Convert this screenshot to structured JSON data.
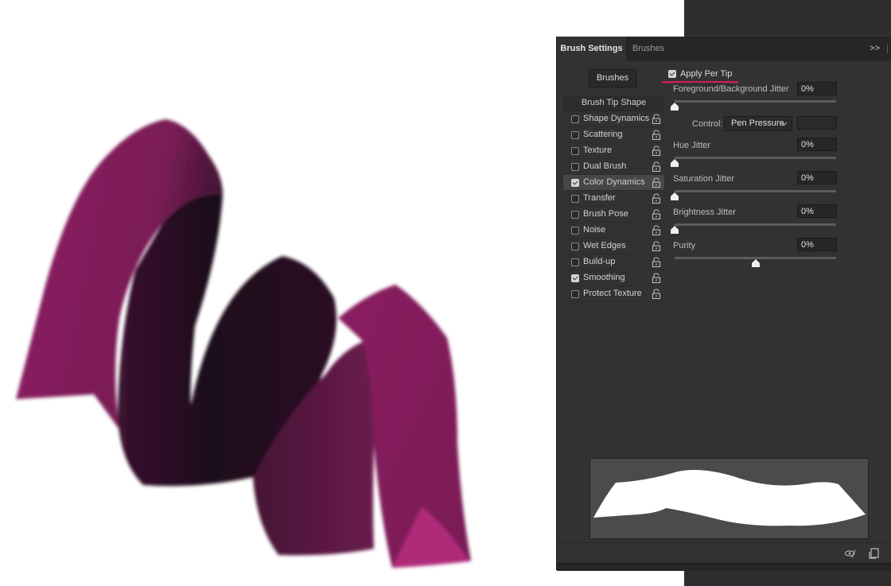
{
  "panel": {
    "tabs": [
      {
        "label": "Brush Settings",
        "active": true
      },
      {
        "label": "Brushes",
        "active": false
      }
    ],
    "menu_icon": "double-chevron-right-icon",
    "brushes_button": "Brushes",
    "list_header": "Brush Tip Shape",
    "items": [
      {
        "label": "Shape Dynamics",
        "checked": false,
        "selected": false
      },
      {
        "label": "Scattering",
        "checked": false,
        "selected": false
      },
      {
        "label": "Texture",
        "checked": false,
        "selected": false
      },
      {
        "label": "Dual Brush",
        "checked": false,
        "selected": false
      },
      {
        "label": "Color Dynamics",
        "checked": true,
        "selected": true
      },
      {
        "label": "Transfer",
        "checked": false,
        "selected": false
      },
      {
        "label": "Brush Pose",
        "checked": false,
        "selected": false
      },
      {
        "label": "Noise",
        "checked": false,
        "selected": false
      },
      {
        "label": "Wet Edges",
        "checked": false,
        "selected": false
      },
      {
        "label": "Build-up",
        "checked": false,
        "selected": false
      },
      {
        "label": "Smoothing",
        "checked": true,
        "selected": false
      },
      {
        "label": "Protect Texture",
        "checked": false,
        "selected": false
      }
    ],
    "apply_per_tip": {
      "label": "Apply Per Tip",
      "checked": true
    },
    "fg_bg_jitter": {
      "label": "Foreground/Background Jitter",
      "value": "0%",
      "fraction": 0
    },
    "control": {
      "label": "Control:",
      "value": "Pen Pressure"
    },
    "hue_jitter": {
      "label": "Hue Jitter",
      "value": "0%",
      "fraction": 0
    },
    "saturation_jitter": {
      "label": "Saturation Jitter",
      "value": "0%",
      "fraction": 0
    },
    "brightness_jitter": {
      "label": "Brightness Jitter",
      "value": "0%",
      "fraction": 0
    },
    "purity": {
      "label": "Purity",
      "value": "0%",
      "fraction": 0.5
    },
    "footer_icons": [
      "toggle-live-tip-preview-icon",
      "create-new-brush-icon"
    ]
  },
  "colors": {
    "stroke_light": "#8e2163",
    "stroke_dark": "#1e0d1c",
    "stroke_mid": "#5c1a45",
    "stroke_highlight": "#b0297a",
    "underline": "#d81e5b",
    "panel_bg": "#323232"
  }
}
